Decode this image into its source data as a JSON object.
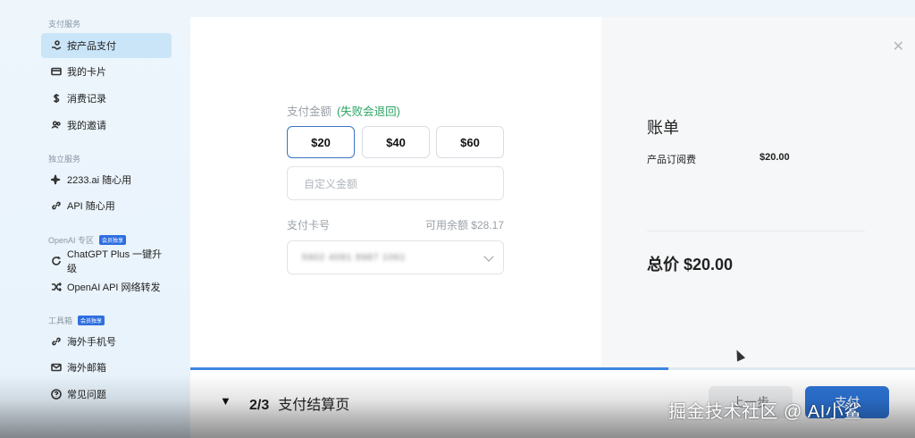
{
  "sidebar": {
    "sections": [
      {
        "title": "支付服务",
        "badge": ""
      },
      {
        "title": "独立服务",
        "badge": ""
      },
      {
        "title": "OpenAI 专区",
        "badge": "会员独享"
      },
      {
        "title": "工具箱",
        "badge": "会员独享"
      }
    ],
    "items": [
      {
        "label": "按产品支付",
        "icon": "hand-coin-icon",
        "active": true
      },
      {
        "label": "我的卡片",
        "icon": "card-icon"
      },
      {
        "label": "消费记录",
        "icon": "dollar-icon"
      },
      {
        "label": "我的邀请",
        "icon": "users-icon"
      },
      {
        "label": "2233.ai 随心用",
        "icon": "sparkle-icon"
      },
      {
        "label": "API 随心用",
        "icon": "link-icon"
      },
      {
        "label": "ChatGPT Plus 一键升级",
        "icon": "refresh-icon"
      },
      {
        "label": "OpenAI API 网络转发",
        "icon": "shuffle-icon"
      },
      {
        "label": "海外手机号",
        "icon": "phone-link-icon"
      },
      {
        "label": "海外邮箱",
        "icon": "mail-icon"
      },
      {
        "label": "常见问题",
        "icon": "help-icon"
      }
    ]
  },
  "payment": {
    "amount_label": "支付金额",
    "amount_note": "(失败会退回)",
    "amounts": [
      "$20",
      "$40",
      "$60"
    ],
    "selected_index": 0,
    "custom_placeholder": "自定义金额",
    "card_label": "支付卡号",
    "balance": "可用余额 $28.17",
    "card_value": "5902 4091 9987 1061"
  },
  "bill": {
    "title": "账单",
    "item_name": "产品订阅费",
    "item_price": "$20.00",
    "total": "总价 $20.00"
  },
  "footer": {
    "toggle": "▼",
    "step": "2/3",
    "step_title": "支付结算页",
    "progress": 0.66,
    "prev_label": "上一步",
    "pay_label": "支付"
  },
  "overlay": {
    "watermark": "掘金技术社区 @ AI小鲨"
  },
  "colors": {
    "accent": "#2d74d6",
    "active_nav": "#cbe5f8",
    "note_green": "#2aa463"
  }
}
